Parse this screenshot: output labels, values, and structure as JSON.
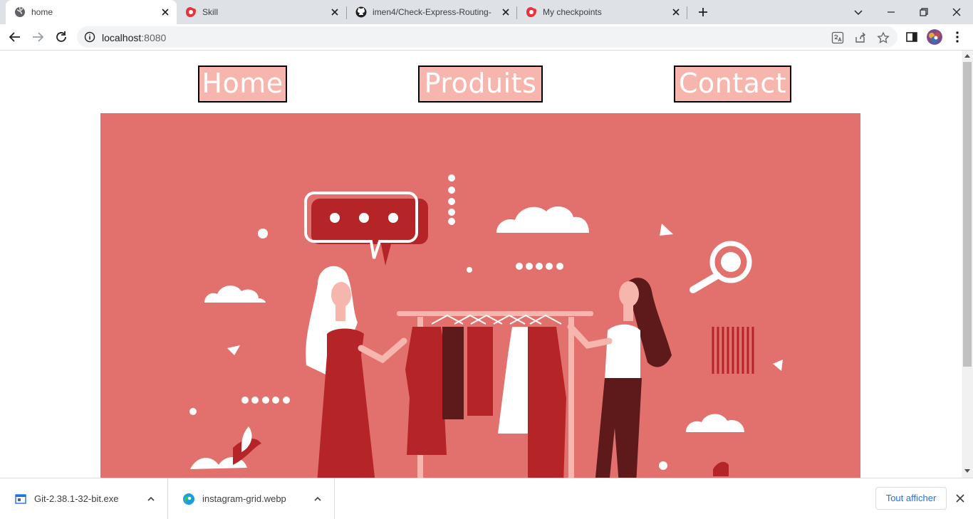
{
  "browser": {
    "tabs": [
      {
        "title": "home",
        "icon": "globe-icon",
        "active": true
      },
      {
        "title": "Skill",
        "icon": "gomycode-icon",
        "active": false
      },
      {
        "title": "imen4/Check-Express-Routing-",
        "icon": "github-icon",
        "active": false
      },
      {
        "title": "My checkpoints",
        "icon": "gomycode-icon",
        "active": false
      }
    ],
    "address": {
      "host": "localhost",
      "port": ":8080"
    }
  },
  "page": {
    "nav": [
      {
        "label": "Home"
      },
      {
        "label": "Produits"
      },
      {
        "label": "Contact"
      }
    ],
    "hero": {
      "image": "boutique-clothing-rack-illustration",
      "background": "#e2716d",
      "accent": "#b52528",
      "dark": "#5e1a1a"
    },
    "nav_color": "#f6b5ad"
  },
  "downloads": {
    "items": [
      {
        "name": "Git-2.38.1-32-bit.exe",
        "icon": "installer-icon"
      },
      {
        "name": "instagram-grid.webp",
        "icon": "edge-icon"
      }
    ],
    "show_all_label": "Tout afficher"
  }
}
